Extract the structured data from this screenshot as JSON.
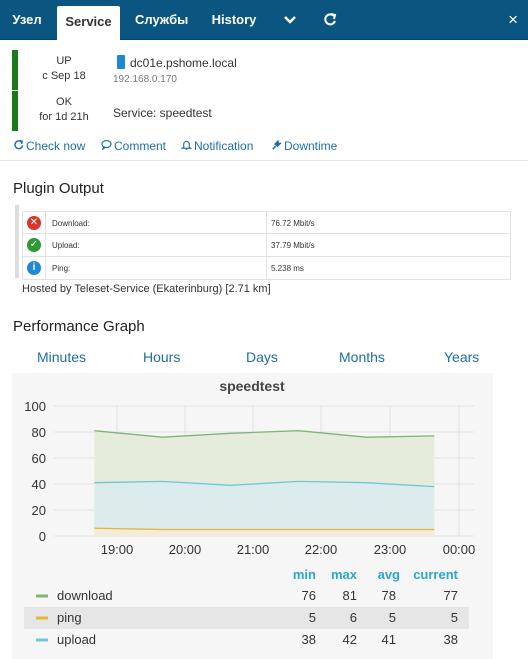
{
  "tabs": {
    "items": [
      {
        "label": "Узел"
      },
      {
        "label": "Service"
      },
      {
        "label": "Службы"
      },
      {
        "label": "History"
      }
    ],
    "more_icon": "chevron-down-icon",
    "refresh_icon": "refresh-icon",
    "close_icon": "close-icon",
    "close_glyph": "×"
  },
  "host_state": {
    "state": "UP",
    "since": "с Sep 18"
  },
  "service_state": {
    "state": "OK",
    "duration": "for 1d 21h"
  },
  "host": {
    "name": "dc01e.pshome.local",
    "ip": "192.168.0.170"
  },
  "service": {
    "label": "Service: speedtest"
  },
  "actions": {
    "check_now": "Check now",
    "comment": "Comment",
    "notification": "Notification",
    "downtime": "Downtime"
  },
  "plugin_output": {
    "title": "Plugin Output",
    "rows": [
      {
        "status": "critical",
        "icon": "cross-circle-icon",
        "label": "Download:",
        "value": "76.72 Mbit/s"
      },
      {
        "status": "ok",
        "icon": "check-circle-icon",
        "label": "Upload:",
        "value": "37.79 Mbit/s"
      },
      {
        "status": "info",
        "icon": "info-circle-icon",
        "label": "Ping:",
        "value": "5.238 ms"
      }
    ],
    "footer": "Hosted by Teleset-Service (Ekaterinburg) [2.71 km]"
  },
  "performance": {
    "title": "Performance Graph",
    "ranges": [
      "Minutes",
      "Hours",
      "Days",
      "Months",
      "Years"
    ]
  },
  "colors": {
    "tabbar": "#0a5680",
    "state_ok": "#1a7a1a",
    "link": "#1e6fa8",
    "download": "#7fb574",
    "ping": "#e3b73c",
    "upload": "#6dc7d9"
  },
  "chart_data": {
    "type": "area",
    "title": "speedtest",
    "ylim": [
      0,
      100
    ],
    "yticks": [
      0,
      20,
      40,
      60,
      80,
      100
    ],
    "xticks": [
      "19:00",
      "20:00",
      "21:00",
      "22:00",
      "23:00",
      "00:00"
    ],
    "x": [
      "18:40",
      "19:40",
      "20:40",
      "21:40",
      "22:40",
      "23:40"
    ],
    "grid": true,
    "series": [
      {
        "name": "download",
        "values": [
          81,
          76,
          79,
          81,
          76,
          77
        ],
        "min": "76",
        "max": "81",
        "avg": "78",
        "current": "77"
      },
      {
        "name": "ping",
        "values": [
          6,
          5,
          5,
          5,
          5,
          5
        ],
        "min": "5",
        "max": "6",
        "avg": "5",
        "current": "5"
      },
      {
        "name": "upload",
        "values": [
          41,
          42,
          39,
          42,
          41,
          38
        ],
        "min": "38",
        "max": "42",
        "avg": "41",
        "current": "38"
      }
    ],
    "legend_headers": [
      "min",
      "max",
      "avg",
      "current"
    ]
  }
}
